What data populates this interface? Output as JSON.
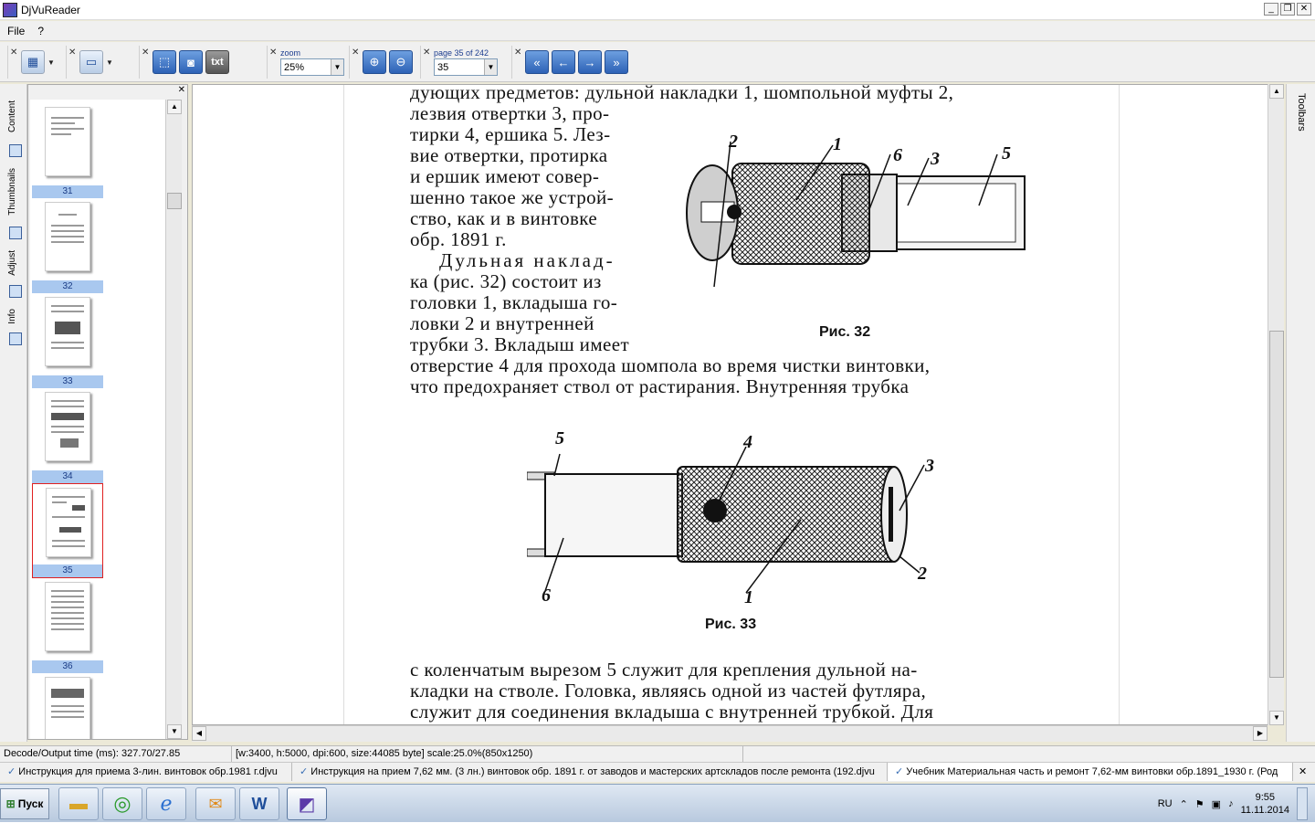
{
  "window": {
    "title": "DjVuReader"
  },
  "menu": {
    "file": "File",
    "help": "?"
  },
  "toolbar": {
    "zoom_label": "zoom",
    "zoom_value": "25%",
    "page_label": "page 35 of 242",
    "page_value": "35",
    "txt_label": "txt"
  },
  "left_tabs": {
    "content": "Content",
    "thumbnails": "Thumbnails",
    "adjust": "Adjust",
    "info": "Info"
  },
  "right_tab": {
    "toolbars": "Toolbars"
  },
  "thumbnails": [
    {
      "num": "31"
    },
    {
      "num": "32"
    },
    {
      "num": "33"
    },
    {
      "num": "34"
    },
    {
      "num": "35"
    },
    {
      "num": "36"
    }
  ],
  "document": {
    "lines_top": [
      "дующих предметов: дульной накладки 1, шомпольной муфты 2,",
      "лезвия отвертки 3, про-",
      "тирки 4, ершика 5. Лез-",
      "вие отвертки, протирка",
      "и ершик имеют совер-",
      "шенно такое же устрой-",
      "ство, как и в винтовке",
      "обр. 1891 г.",
      "Дульная наклад-",
      "ка (рис. 32) состоит из",
      "головки 1, вкладыша го-",
      "ловки 2 и внутренней",
      "трубки 3. Вкладыш имеет"
    ],
    "lines_mid": [
      "отверстие 4 для прохода шомпола во время чистки винтовки,",
      "что предохраняет ствол от растирания. Внутренняя трубка"
    ],
    "lines_bottom": [
      "с коленчатым вырезом 5 служит для крепления дульной на-",
      "кладки на стволе. Головка, являясь одной из частей футляра,",
      "служит для соединения вкладыша с внутренней трубкой. Для"
    ],
    "fig32_caption": "Рис. 32",
    "fig33_caption": "Рис. 33",
    "fig32_callouts": [
      "2",
      "1",
      "6",
      "3",
      "5"
    ],
    "fig33_callouts": [
      "5",
      "4",
      "3",
      "2",
      "1",
      "6"
    ]
  },
  "status": {
    "decode": "Decode/Output time (ms): 327.70/27.85",
    "info": "[w:3400, h:5000, dpi:600, size:44085 byte] scale:25.0%(850x1250)"
  },
  "doc_tabs": [
    "Инструкция для приема 3-лин. винтовок обр.1981 г.djvu",
    "Инструкция на прием 7,62 мм. (3 лн.) винтовок обр. 1891 г. от заводов и мастерских артскладов после ремонта (192.djvu",
    "Учебник Материальная часть и ремонт 7,62-мм винтовки обр.1891_1930 г. (Род"
  ],
  "taskbar": {
    "start": "Пуск",
    "lang": "RU",
    "time": "9:55",
    "date": "11.11.2014"
  }
}
